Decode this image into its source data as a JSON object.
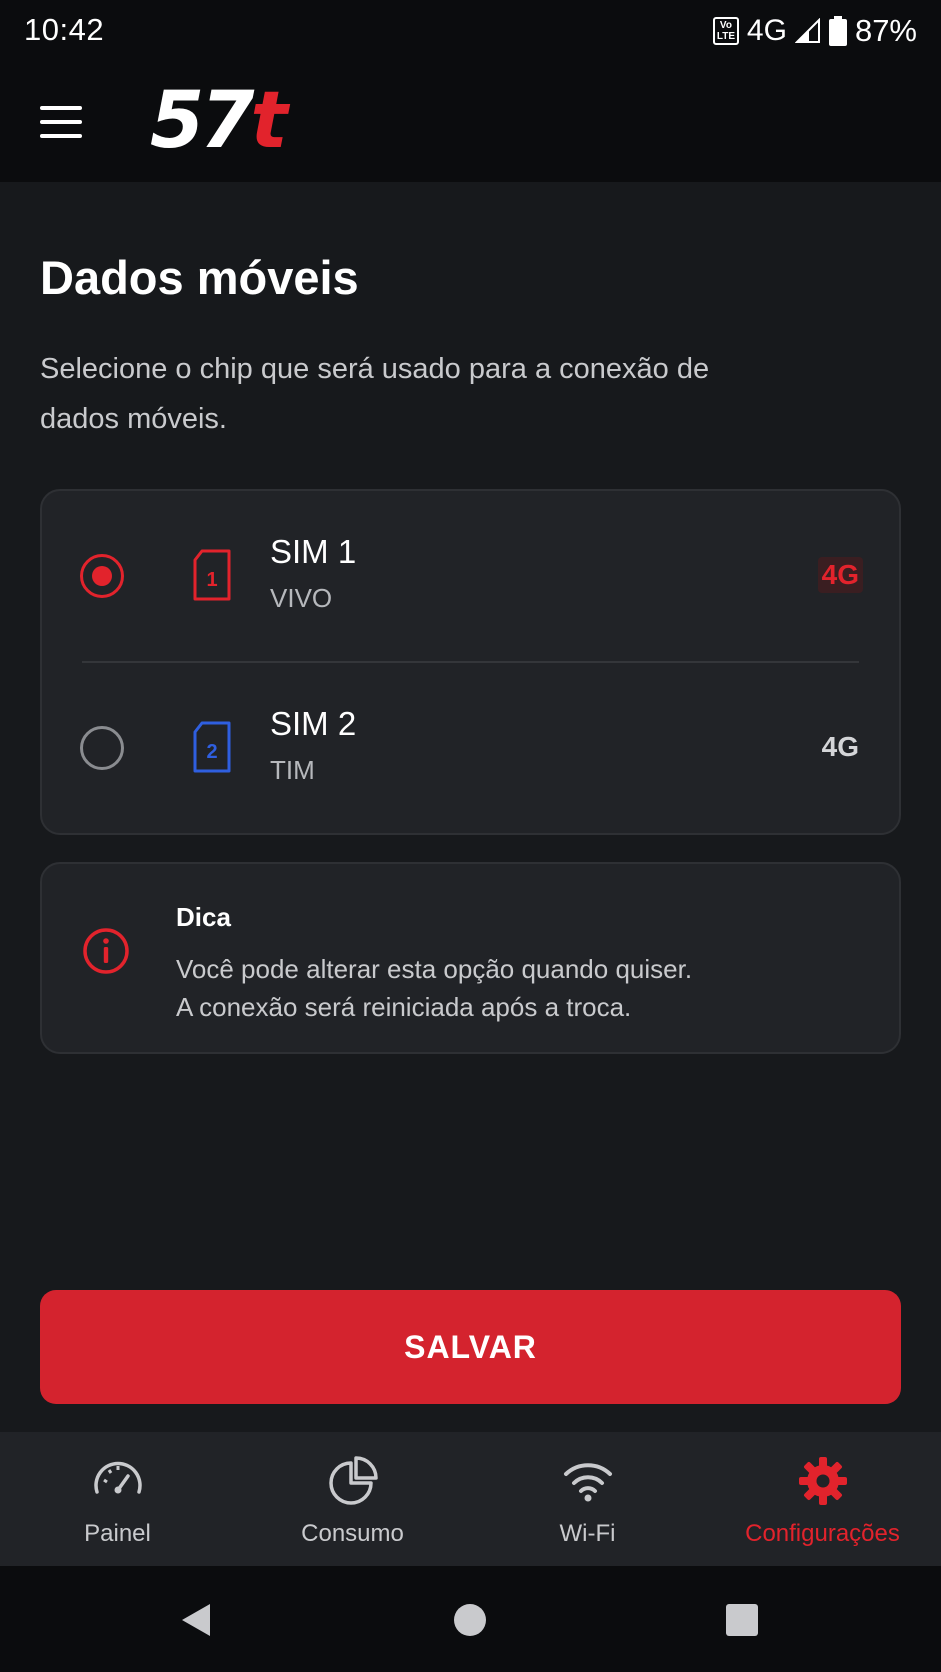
{
  "status_bar": {
    "time": "10:42",
    "volte_top": "Vo",
    "volte_bottom": "LTE",
    "network": "4G",
    "battery": "87%"
  },
  "header": {
    "logo_main": "57",
    "logo_accent": "t"
  },
  "page": {
    "title": "Dados móveis",
    "description": "Selecione o chip que será usado para a conexão de dados móveis."
  },
  "sims": [
    {
      "name": "SIM 1",
      "carrier": "VIVO",
      "network": "4G",
      "slot": "1",
      "selected": true,
      "color": "#e2232c"
    },
    {
      "name": "SIM 2",
      "carrier": "TIM",
      "network": "4G",
      "slot": "2",
      "selected": false,
      "color": "#2f5fe0"
    }
  ],
  "tip": {
    "title": "Dica",
    "line1": "Você pode alterar esta opção quando quiser.",
    "line2": "A conexão será reiniciada após a troca."
  },
  "actions": {
    "save_label": "SALVAR"
  },
  "bottom_nav": {
    "items": [
      {
        "label": "Painel",
        "icon": "speedometer-icon",
        "active": false
      },
      {
        "label": "Consumo",
        "icon": "pie-chart-icon",
        "active": false
      },
      {
        "label": "Wi-Fi",
        "icon": "wifi-icon",
        "active": false
      },
      {
        "label": "Configurações",
        "icon": "gear-icon",
        "active": true
      }
    ]
  },
  "colors": {
    "accent": "#e2232c",
    "background": "#17191c",
    "card": "#212327",
    "sim2_blue": "#2f5fe0"
  }
}
